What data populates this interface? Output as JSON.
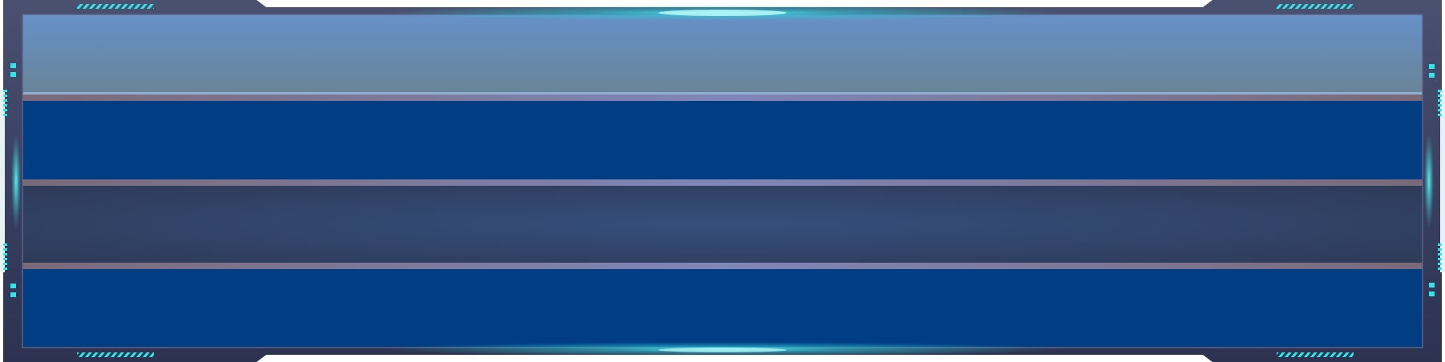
{
  "panel": {
    "rows": [
      {
        "id": "row-1",
        "label": "",
        "style": "header"
      },
      {
        "id": "row-2",
        "label": "",
        "style": "dark-blue"
      },
      {
        "id": "row-3",
        "label": "",
        "style": "slate"
      },
      {
        "id": "row-4",
        "label": "",
        "style": "dark-blue"
      }
    ]
  },
  "colors": {
    "frame": "#39405e",
    "frame_dark": "#2a3049",
    "accent_cyan": "#2ee6e6",
    "header_top": "#6690c8",
    "header_bottom": "#688496",
    "row_dark_blue": "#003d82",
    "row_slate": "#344668",
    "separator": "#7a6f86"
  }
}
